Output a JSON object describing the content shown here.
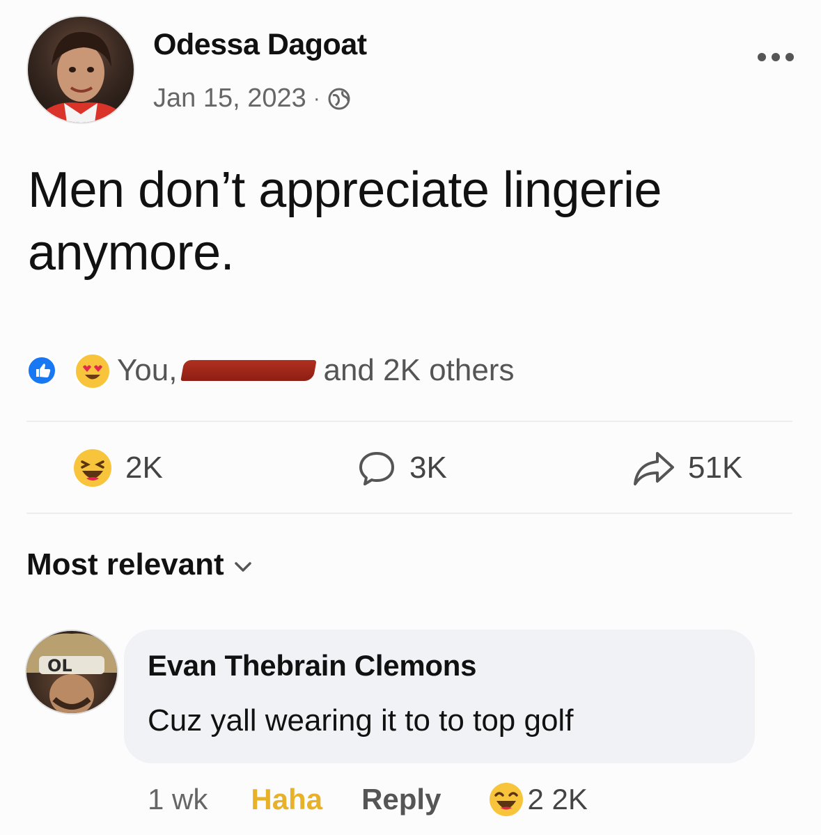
{
  "post": {
    "author": "Odessa Dagoat",
    "date": "Jan 15, 2023",
    "meta_separator": "·",
    "audience_icon": "globe-icon",
    "text": "Men don’t appreciate lingerie anymore."
  },
  "reactions_summary": {
    "icons": [
      "like-icon",
      "heart-eyes-icon"
    ],
    "prefix": "You,",
    "suffix": "and 2K others"
  },
  "counts": {
    "reactions": "2K",
    "comments": "3K",
    "shares": "51K"
  },
  "comments_section": {
    "sort_label": "Most relevant"
  },
  "comment": {
    "author": "Evan Thebrain Clemons",
    "avatar_text": "OL",
    "text": "Cuz yall wearing it to to top golf",
    "timestamp": "1 wk",
    "reaction_label": "Haha",
    "reply_label": "Reply",
    "reaction_count": "2 2K"
  },
  "colors": {
    "like_blue": "#1877f2",
    "haha_yellow": "#e7b22a",
    "bubble_bg": "#f0f2f5",
    "redaction_red": "#9c2418"
  }
}
